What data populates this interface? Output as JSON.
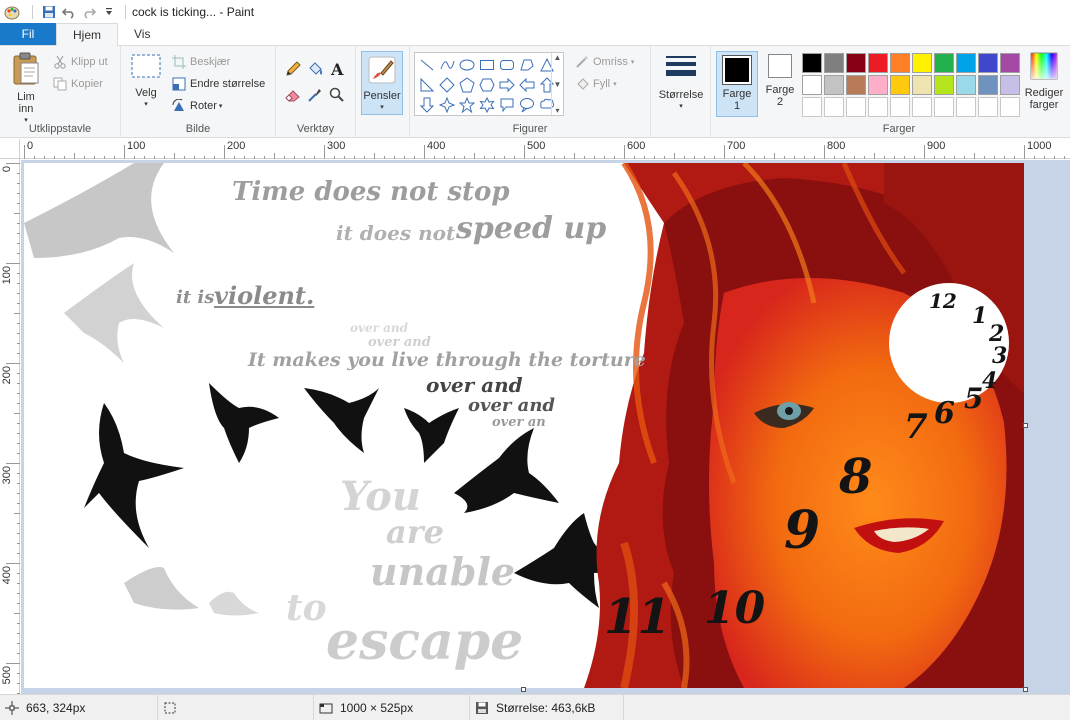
{
  "window": {
    "title": "cock is ticking... - Paint"
  },
  "tabs": [
    {
      "label": "Fil"
    },
    {
      "label": "Hjem"
    },
    {
      "label": "Vis"
    }
  ],
  "clipboard": {
    "paste_label": "Lim\ninn",
    "cut_label": "Klipp ut",
    "copy_label": "Kopier",
    "group_label": "Utklippstavle"
  },
  "image": {
    "select_label": "Velg",
    "crop_label": "Beskjær",
    "resize_label": "Endre størrelse",
    "rotate_label": "Roter",
    "group_label": "Bilde"
  },
  "tools": {
    "group_label": "Verktøy"
  },
  "brushes": {
    "label": "Pensler"
  },
  "shapes": {
    "outline_label": "Omriss",
    "fill_label": "Fyll",
    "group_label": "Figurer"
  },
  "size": {
    "label": "Størrelse"
  },
  "colors": {
    "color1_label": "Farge\n1",
    "color2_label": "Farge\n2",
    "edit_label": "Rediger\nfarger",
    "group_label": "Farger",
    "color1_value": "#000000",
    "color2_value": "#ffffff",
    "palette": [
      "#000000",
      "#7f7f7f",
      "#880015",
      "#ed1c24",
      "#ff7f27",
      "#fff200",
      "#22b14c",
      "#00a2e8",
      "#3f48cc",
      "#a349a4",
      "#ffffff",
      "#c3c3c3",
      "#b97a57",
      "#ffaec9",
      "#ffc90e",
      "#efe4b0",
      "#b5e61d",
      "#99d9ea",
      "#7092be",
      "#c8bfe7",
      "#ffffff",
      "#ffffff",
      "#ffffff",
      "#ffffff",
      "#ffffff",
      "#ffffff",
      "#ffffff",
      "#ffffff",
      "#ffffff",
      "#ffffff"
    ]
  },
  "ruler": {
    "h_labels": [
      "0",
      "100",
      "200",
      "300",
      "400",
      "500",
      "600",
      "700",
      "800",
      "900",
      "1000"
    ],
    "v_labels": [
      "0",
      "100",
      "200",
      "300",
      "400",
      "500"
    ]
  },
  "artwork": {
    "lines": [
      "Time does not stop",
      "it does not",
      "speed up",
      "it is",
      "violent.",
      "over and",
      "over and",
      "It makes you live through the torture",
      "over and",
      "over and",
      "over an",
      "You",
      "are",
      "unable",
      "to",
      "escape"
    ],
    "clock_numbers": [
      "12",
      "1",
      "2",
      "3",
      "4",
      "5",
      "6",
      "7",
      "8",
      "9",
      "10",
      "11"
    ]
  },
  "status": {
    "cursor_pos": "663, 324px",
    "selection_size": "",
    "image_size": "1000 × 525px",
    "file_size": "Størrelse: 463,6kB"
  }
}
